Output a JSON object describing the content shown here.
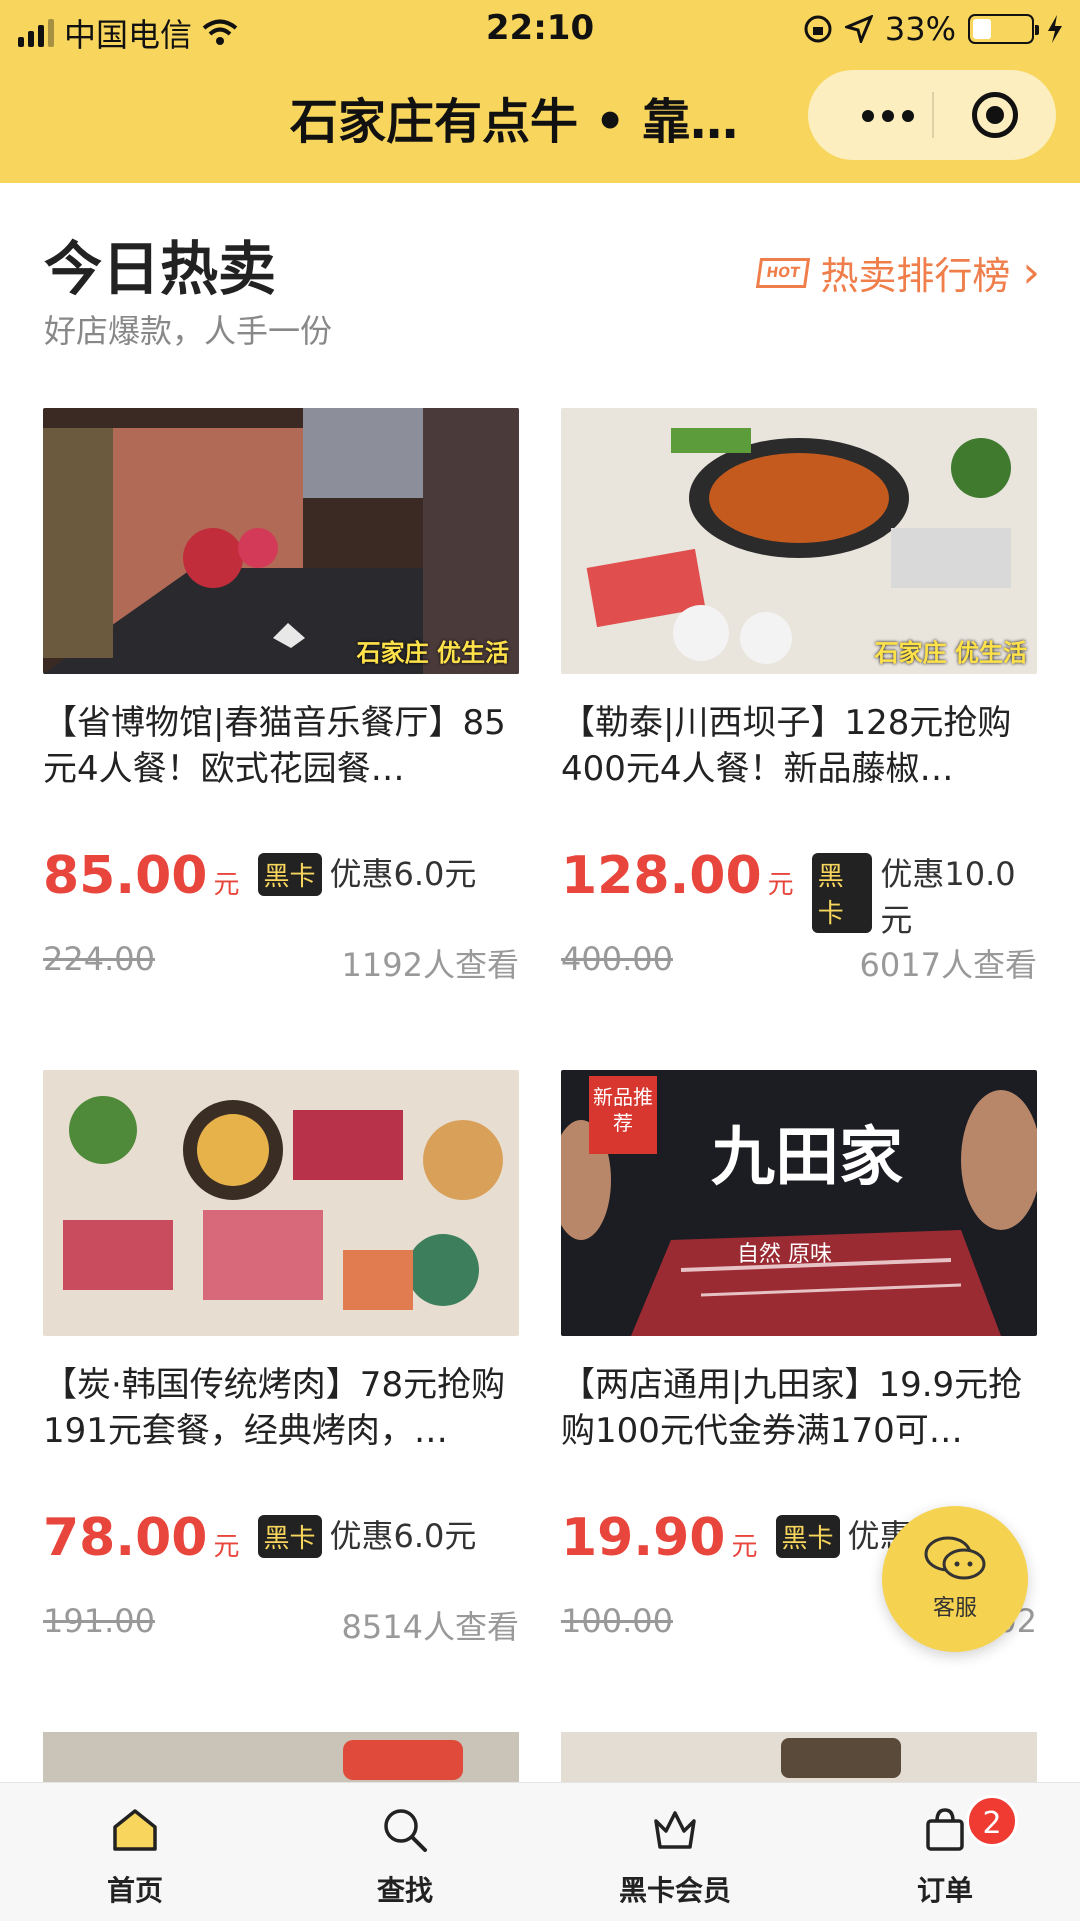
{
  "status_bar": {
    "carrier": "中国电信",
    "time": "22:10",
    "battery": "33%"
  },
  "nav": {
    "title": "石家庄有点牛 • 靠…"
  },
  "section": {
    "title": "今日热卖",
    "subtitle": "好店爆款，人手一份",
    "hot_badge": "HOT",
    "rank_link": "热卖排行榜"
  },
  "products": [
    {
      "name": "【省博物馆|春猫音乐餐厅】85元4人餐！欧式花园餐…",
      "price": "85.00",
      "unit": "元",
      "vip_tag": "黑卡",
      "discount": "优惠6.0元",
      "original": "224.00",
      "views": "1192人查看",
      "watermark": "石家庄 优生活"
    },
    {
      "name": "【勒泰|川西坝子】128元抢购400元4人餐！新品藤椒…",
      "price": "128.00",
      "unit": "元",
      "vip_tag": "黑卡",
      "discount": "优惠10.0元",
      "original": "400.00",
      "views": "6017人查看",
      "watermark": "石家庄 优生活"
    },
    {
      "name": "【炭·韩国传统烤肉】78元抢购191元套餐，经典烤肉，…",
      "price": "78.00",
      "unit": "元",
      "vip_tag": "黑卡",
      "discount": "优惠6.0元",
      "original": "191.00",
      "views": "8514人查看"
    },
    {
      "name": "【两店通用|九田家】19.9元抢购100元代金券满170可…",
      "price": "19.90",
      "unit": "元",
      "vip_tag": "黑卡",
      "discount": "优惠",
      "original": "100.00",
      "views": "102",
      "new_tag": "新品推荐",
      "brand": "九田家",
      "brand_sub": "自然 原味"
    }
  ],
  "fab": {
    "label": "客服"
  },
  "tabbar": {
    "items": [
      {
        "label": "首页",
        "icon": "home-icon"
      },
      {
        "label": "查找",
        "icon": "search-icon"
      },
      {
        "label": "黑卡会员",
        "icon": "crown-icon"
      },
      {
        "label": "订单",
        "icon": "bag-icon"
      }
    ],
    "order_badge": "2"
  },
  "colors": {
    "topbar": "#f8d55c",
    "price": "#e8453c",
    "rank_link": "#f07e4a"
  }
}
